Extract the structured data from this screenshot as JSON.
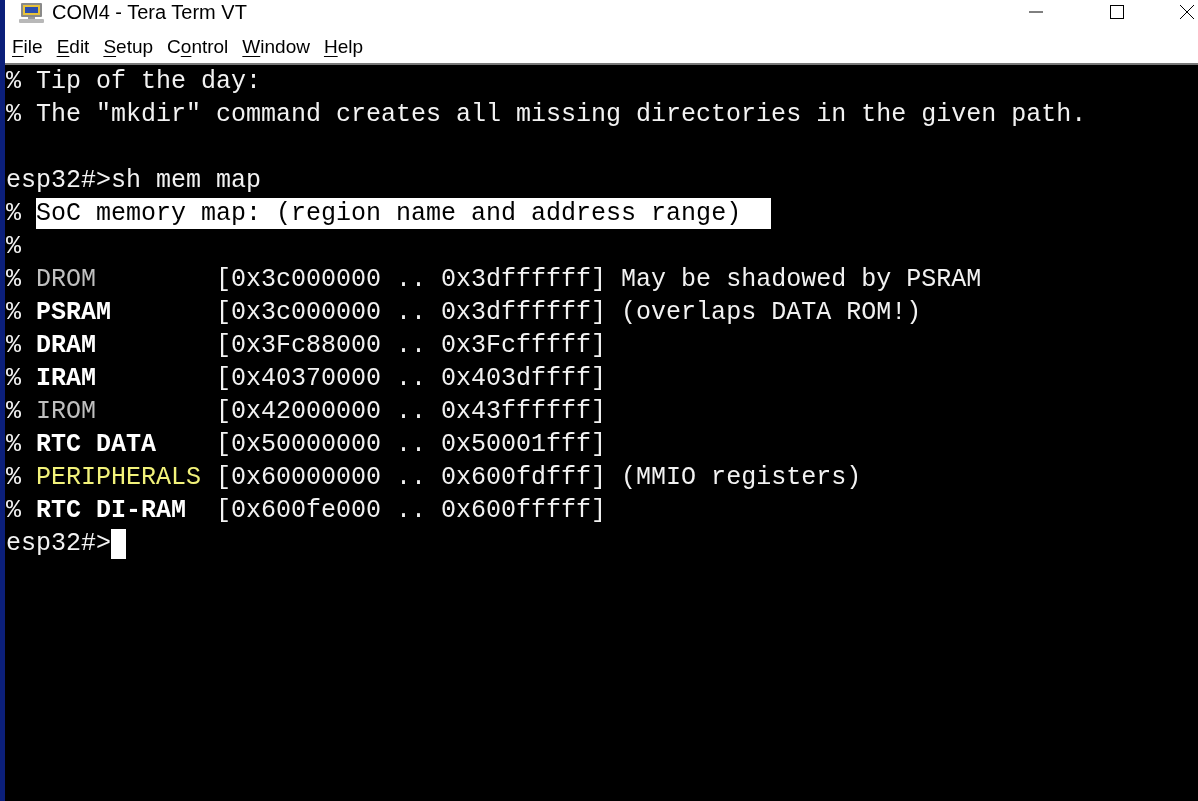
{
  "window": {
    "title": "COM4 - Tera Term VT"
  },
  "menu": [
    {
      "mnemonic": "F",
      "after": "ile"
    },
    {
      "mnemonic": "E",
      "after": "dit"
    },
    {
      "mnemonic": "S",
      "after": "etup"
    },
    {
      "before": "C",
      "mnemonic": "o",
      "after": "ntrol"
    },
    {
      "mnemonic": "W",
      "after": "indow"
    },
    {
      "mnemonic": "H",
      "after": "elp"
    }
  ],
  "terminal": {
    "lines": [
      {
        "kind": "text",
        "text": "% Tip of the day:"
      },
      {
        "kind": "text",
        "text": "% The \"mkdir\" command creates all missing directories in the given path."
      },
      {
        "kind": "blank"
      },
      {
        "kind": "text",
        "text": "esp32#>sh mem map"
      },
      {
        "kind": "heading",
        "prefix": "%",
        "text": "SoC memory map: (region name and address range)",
        "inverse": true
      },
      {
        "kind": "text",
        "text": "%"
      },
      {
        "kind": "region",
        "prefix": "%",
        "name": "DROM",
        "color": "#c0c0c0",
        "bold": false,
        "range": "[0x3c000000 .. 0x3dffffff]",
        "note": "May be shadowed by PSRAM"
      },
      {
        "kind": "region",
        "prefix": "%",
        "name": "PSRAM",
        "color": "#ffffff",
        "bold": true,
        "range": "[0x3c000000 .. 0x3dffffff]",
        "note": "(overlaps DATA ROM!)"
      },
      {
        "kind": "region",
        "prefix": "%",
        "name": "DRAM",
        "color": "#ffffff",
        "bold": true,
        "range": "[0x3Fc88000 .. 0x3Fcfffff]"
      },
      {
        "kind": "region",
        "prefix": "%",
        "name": "IRAM",
        "color": "#ffffff",
        "bold": true,
        "range": "[0x40370000 .. 0x403dffff]"
      },
      {
        "kind": "region",
        "prefix": "%",
        "name": "IROM",
        "color": "#c0c0c0",
        "bold": false,
        "range": "[0x42000000 .. 0x43ffffff]"
      },
      {
        "kind": "region",
        "prefix": "%",
        "name": "RTC DATA",
        "color": "#ffffff",
        "bold": true,
        "range": "[0x50000000 .. 0x50001fff]"
      },
      {
        "kind": "region",
        "prefix": "%",
        "name": "PERIPHERALS",
        "color": "#f2f27a",
        "bold": false,
        "range": "[0x60000000 .. 0x600fdfff]",
        "note": "(MMIO registers)"
      },
      {
        "kind": "region",
        "prefix": "%",
        "name": "RTC DI-RAM",
        "color": "#ffffff",
        "bold": true,
        "range": "[0x600fe000 .. 0x600fffff]"
      },
      {
        "kind": "prompt",
        "text": "esp32#>",
        "cursor": true
      }
    ]
  }
}
